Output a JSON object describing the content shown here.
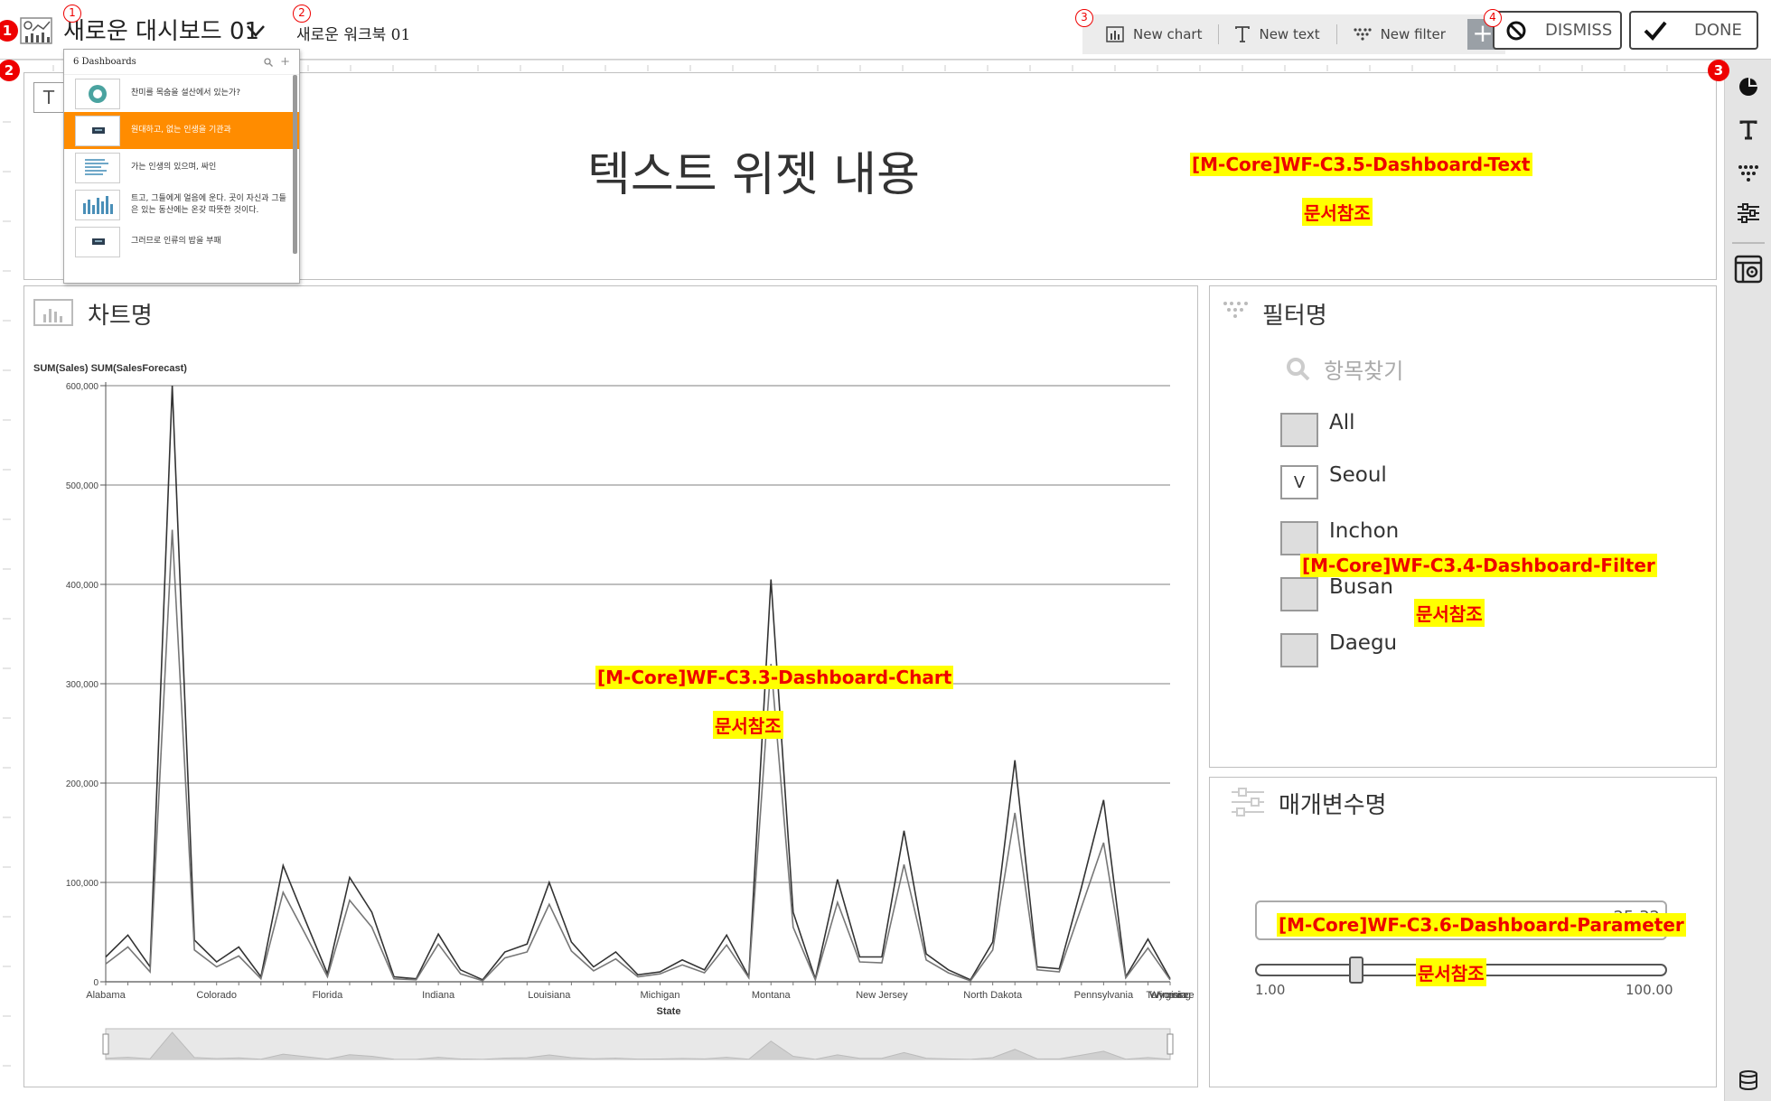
{
  "header": {
    "dashboard_title": "새로운 대시보드 01",
    "workbook_name": "새로운 워크북 01",
    "toolbar": {
      "new_chart": "New chart",
      "new_text": "New text",
      "new_filter": "New filter",
      "add": "+"
    },
    "dismiss_label": "DISMISS",
    "done_label": "DONE"
  },
  "markers": {
    "red": [
      "1",
      "2",
      "3"
    ],
    "circled": [
      "1",
      "2",
      "3",
      "4"
    ]
  },
  "dropdown": {
    "count_label": "6 Dashboards",
    "items": [
      {
        "text": "찬미를 목숨을 설산에서 있는가?",
        "selected": false
      },
      {
        "text": "원대하고, 없는 인생을 기관과",
        "selected": true
      },
      {
        "text": "가는 인생의 있으며, 싸인",
        "selected": false
      },
      {
        "text": "트고, 그들에게 얼음에 운다. 곳이 자신과 그들은 있는 동산에는 온갖 따뜻한 것이다.",
        "selected": false
      },
      {
        "text": "그러므로 인류의 밥을 부패",
        "selected": false
      }
    ]
  },
  "text_widget": {
    "icon_label": "T",
    "content": "텍스트 위젯 내용",
    "ref_code": "[M-Core]WF-C3.5-Dashboard-Text",
    "ref_note": "문서참조"
  },
  "chart_widget": {
    "title": "차트명",
    "ref_code": "[M-Core]WF-C3.3-Dashboard-Chart",
    "ref_note": "문서참조"
  },
  "filter_widget": {
    "title": "필터명",
    "search_placeholder": "항목찾기",
    "items": [
      {
        "label": "All",
        "checked": false,
        "mark": ""
      },
      {
        "label": "Seoul",
        "checked": true,
        "mark": "V"
      },
      {
        "label": "Inchon",
        "checked": false,
        "mark": ""
      },
      {
        "label": "Busan",
        "checked": false,
        "mark": ""
      },
      {
        "label": "Daegu",
        "checked": false,
        "mark": ""
      }
    ],
    "ref_code": "[M-Core]WF-C3.4-Dashboard-Filter",
    "ref_note": "문서참조"
  },
  "parameter_widget": {
    "title": "매개변수명",
    "value": "25.32",
    "min_label": "1.00",
    "max_label": "100.00",
    "min": 1.0,
    "max": 100.0,
    "current": 25.32,
    "ref_code": "[M-Core]WF-C3.6-Dashboard-Parameter",
    "ref_note": "문서참조"
  },
  "right_rail": {
    "icons": [
      "pie-chart-icon",
      "text-icon",
      "filter-icon",
      "sliders-icon",
      "layout-settings-icon",
      "database-icon"
    ]
  },
  "chart_data": {
    "type": "line",
    "ylabel": "SUM(Sales)  SUM(SalesForecast)",
    "xlabel": "State",
    "ylim": [
      0,
      600000
    ],
    "y_ticks": [
      "0",
      "100,000",
      "200,000",
      "300,000",
      "400,000",
      "500,000",
      "600,000"
    ],
    "y_tick_values": [
      0,
      100000,
      200000,
      300000,
      400000,
      500000,
      600000
    ],
    "x_tick_labels": [
      "Alabama",
      "Colorado",
      "Florida",
      "Indiana",
      "Louisiana",
      "Michigan",
      "Montana",
      "New Jersey",
      "North Dakota",
      "Pennsylvania",
      "Tennessee",
      "Virginia",
      "Wyoming"
    ],
    "x_tick_index": [
      0,
      5,
      10,
      15,
      20,
      25,
      30,
      35,
      40,
      45,
      50,
      55,
      60
    ],
    "series": [
      {
        "values": [
          25000,
          47000,
          15000,
          600000,
          42000,
          20000,
          35000,
          5000,
          117000,
          62000,
          8000,
          105000,
          70000,
          5000,
          3000,
          48000,
          12000,
          2000,
          30000,
          38000,
          100000,
          40000,
          15000,
          30000,
          7000,
          10000,
          22000,
          12000,
          47000,
          5000,
          405000,
          70000,
          3000,
          103000,
          25000,
          25000,
          152000,
          28000,
          12000,
          2000,
          40000,
          223000,
          15000,
          13000,
          95000,
          183000,
          5000,
          43000,
          3000
        ]
      },
      {
        "values": [
          18000,
          35000,
          10000,
          455000,
          32000,
          15000,
          26000,
          3000,
          90000,
          48000,
          5000,
          82000,
          55000,
          3000,
          2000,
          38000,
          8000,
          1000,
          24000,
          30000,
          78000,
          31000,
          11000,
          23000,
          5000,
          8000,
          17000,
          9000,
          37000,
          4000,
          320000,
          55000,
          2000,
          80000,
          20000,
          19000,
          118000,
          22000,
          9000,
          1000,
          32000,
          170000,
          12000,
          10000,
          75000,
          140000,
          4000,
          34000,
          2000
        ]
      }
    ]
  }
}
